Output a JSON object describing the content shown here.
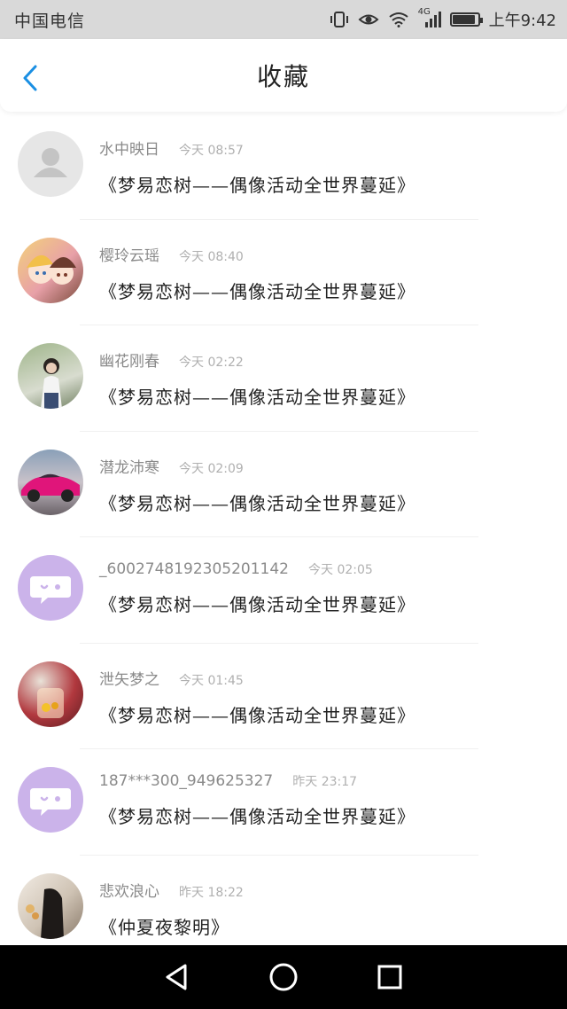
{
  "status_bar": {
    "carrier": "中国电信",
    "network": "4G",
    "time": "上午9:42",
    "battery_level": 0.9
  },
  "header": {
    "title": "收藏",
    "back_icon": "chevron-left-icon",
    "accent_color": "#1a8fe3"
  },
  "items": [
    {
      "user": "水中映日",
      "time": "今天 08:57",
      "title": "《梦易恋树——偶像活动全世界蔓延》",
      "avatar": "default-person"
    },
    {
      "user": "樱玲云瑶",
      "time": "今天 08:40",
      "title": "《梦易恋树——偶像活动全世界蔓延》",
      "avatar": "anime-girls"
    },
    {
      "user": "幽花刚春",
      "time": "今天 02:22",
      "title": "《梦易恋树——偶像活动全世界蔓延》",
      "avatar": "photo-girl"
    },
    {
      "user": "潜龙沛寒",
      "time": "今天 02:09",
      "title": "《梦易恋树——偶像活动全世界蔓延》",
      "avatar": "pink-car"
    },
    {
      "user": "_6002748192305201142",
      "time": "今天 02:05",
      "title": "《梦易恋树——偶像活动全世界蔓延》",
      "avatar": "purple-chat"
    },
    {
      "user": "泄矢梦之",
      "time": "今天 01:45",
      "title": "《梦易恋树——偶像活动全世界蔓延》",
      "avatar": "jar-photo"
    },
    {
      "user": "187***300_949625327",
      "time": "昨天 23:17",
      "title": "《梦易恋树——偶像活动全世界蔓延》",
      "avatar": "purple-chat"
    },
    {
      "user": "悲欢浪心",
      "time": "昨天 18:22",
      "title": "《仲夏夜黎明》",
      "avatar": "photo-girl-dark"
    }
  ],
  "nav": {
    "back": "triangle-back-icon",
    "home": "circle-home-icon",
    "recents": "square-recents-icon"
  }
}
